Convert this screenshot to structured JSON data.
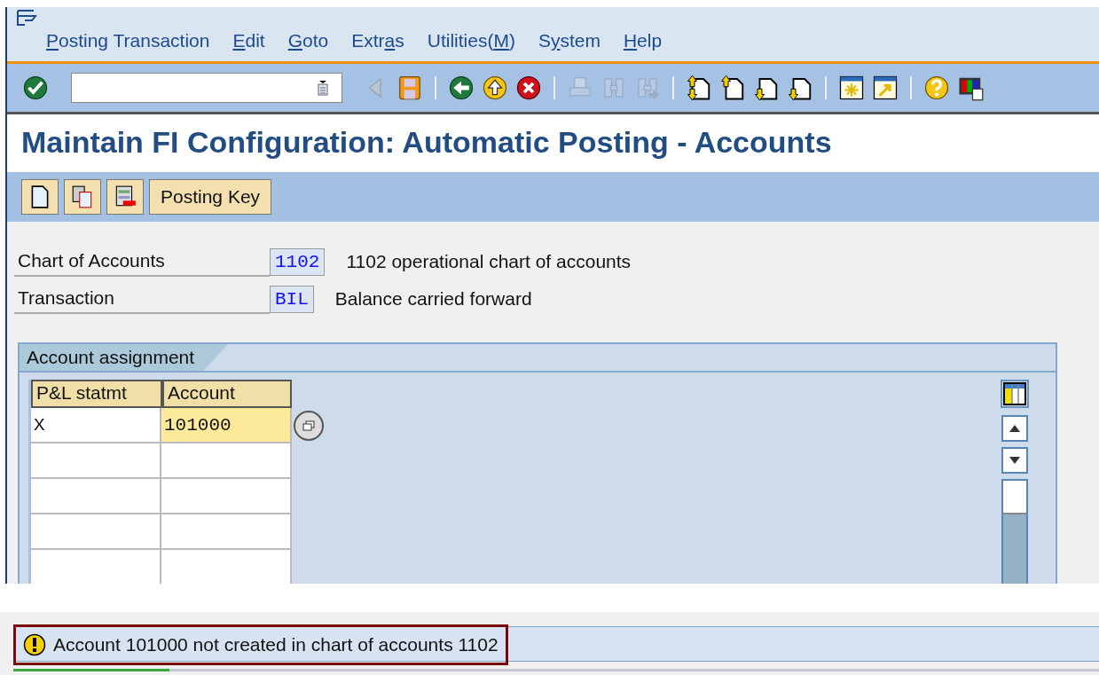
{
  "menu_bar": [
    {
      "key": "P",
      "post": "osting Transaction"
    },
    {
      "key": "E",
      "post": "dit"
    },
    {
      "key": "G",
      "post": "oto"
    },
    {
      "pre": "Extr",
      "key": "a",
      "post": "s"
    },
    {
      "pre": "Utilities(",
      "key": "M",
      "post": ")"
    },
    {
      "pre": "S",
      "key": "y",
      "post": "stem"
    },
    {
      "key": "H",
      "post": "elp"
    }
  ],
  "toolbar": [
    {
      "kind": "enter",
      "disabled": false
    },
    {
      "kind": "command-field"
    },
    {
      "kind": "back-nav",
      "disabled": true
    },
    {
      "kind": "save",
      "disabled": false
    },
    {
      "kind": "separator"
    },
    {
      "kind": "back",
      "disabled": false
    },
    {
      "kind": "exit",
      "disabled": false
    },
    {
      "kind": "cancel",
      "disabled": false
    },
    {
      "kind": "separator"
    },
    {
      "kind": "print",
      "disabled": true
    },
    {
      "kind": "find",
      "disabled": true
    },
    {
      "kind": "find-next",
      "disabled": true
    },
    {
      "kind": "separator"
    },
    {
      "kind": "first-page",
      "disabled": false
    },
    {
      "kind": "previous-page",
      "disabled": false
    },
    {
      "kind": "next-page",
      "disabled": false
    },
    {
      "kind": "last-page",
      "disabled": false
    },
    {
      "kind": "separator"
    },
    {
      "kind": "new-session",
      "disabled": false
    },
    {
      "kind": "shortcut",
      "disabled": false
    },
    {
      "kind": "separator"
    },
    {
      "kind": "help",
      "disabled": false
    },
    {
      "kind": "layout",
      "disabled": false
    }
  ],
  "title": "Maintain FI Configuration: Automatic Posting - Accounts",
  "app_toolbar": [
    {
      "kind": "new-entry"
    },
    {
      "kind": "copy"
    },
    {
      "kind": "delete"
    },
    {
      "kind": "text",
      "label": "Posting Key"
    }
  ],
  "fields": [
    {
      "label": "Chart of Accounts",
      "value": "1102",
      "description": "1102 operational chart of accounts"
    },
    {
      "label": "Transaction",
      "value": "BIL",
      "description": "Balance carried forward"
    }
  ],
  "group": {
    "title": "Account assignment",
    "columns": [
      "P&L statmt",
      "Account"
    ],
    "rows": [
      {
        "value_help": true,
        "cells": [
          {
            "text": "X",
            "highlighted": false
          },
          {
            "text": "101000",
            "highlighted": true
          }
        ]
      }
    ]
  },
  "status": {
    "kind": "warning",
    "text": "Account 101000 not created in chart of accounts 1102"
  }
}
